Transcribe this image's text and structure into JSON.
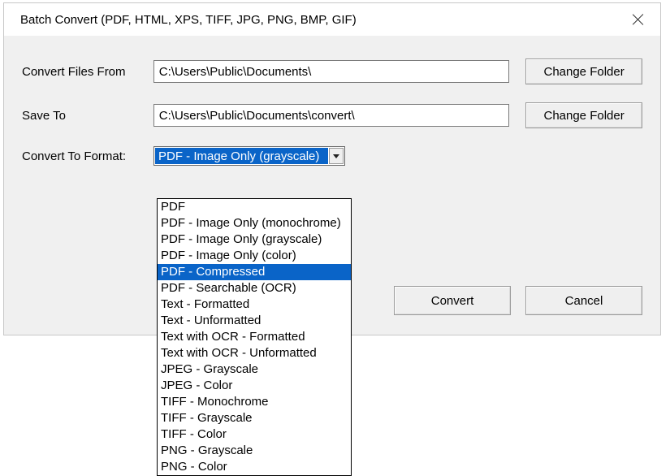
{
  "title": "Batch Convert (PDF, HTML, XPS, TIFF, JPG, PNG, BMP, GIF)",
  "labels": {
    "from": "Convert Files From",
    "saveTo": "Save To",
    "format": "Convert To Format:"
  },
  "paths": {
    "from": "C:\\Users\\Public\\Documents\\",
    "saveTo": "C:\\Users\\Public\\Documents\\convert\\"
  },
  "buttons": {
    "changeFolder": "Change Folder",
    "convert": "Convert",
    "cancel": "Cancel"
  },
  "combo": {
    "selected": "PDF - Image Only (grayscale)"
  },
  "dropdown": {
    "highlightedIndex": 4,
    "options": [
      "PDF",
      "PDF - Image Only (monochrome)",
      "PDF - Image Only (grayscale)",
      "PDF - Image Only (color)",
      "PDF - Compressed",
      "PDF - Searchable (OCR)",
      "Text - Formatted",
      "Text - Unformatted",
      "Text with OCR - Formatted",
      "Text with OCR - Unformatted",
      "JPEG - Grayscale",
      "JPEG - Color",
      "TIFF - Monochrome",
      "TIFF - Grayscale",
      "TIFF - Color",
      "PNG - Grayscale",
      "PNG - Color"
    ]
  }
}
